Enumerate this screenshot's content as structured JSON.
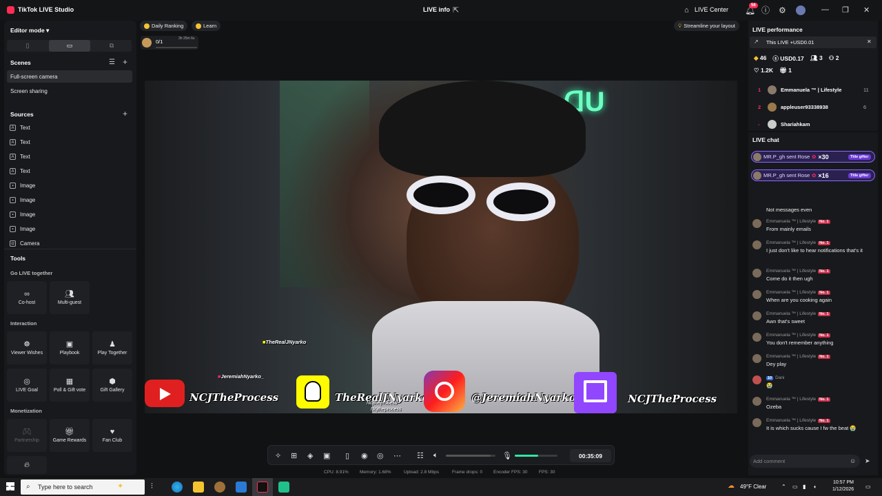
{
  "titlebar": {
    "app": "TikTok LIVE Studio",
    "center": "LIVE info",
    "live_center": "LIVE Center",
    "notif_count": "56"
  },
  "left": {
    "editor_mode": "Editor mode",
    "scenes_title": "Scenes",
    "scenes": [
      "Full-screen camera",
      "Screen sharing"
    ],
    "sources_title": "Sources",
    "sources": [
      {
        "icon": "text-icon",
        "label": "Text"
      },
      {
        "icon": "text-icon",
        "label": "Text"
      },
      {
        "icon": "text-icon",
        "label": "Text"
      },
      {
        "icon": "text-icon",
        "label": "Text"
      },
      {
        "icon": "image-icon",
        "label": "Image"
      },
      {
        "icon": "image-icon",
        "label": "Image"
      },
      {
        "icon": "image-icon",
        "label": "Image"
      },
      {
        "icon": "image-icon",
        "label": "Image"
      },
      {
        "icon": "camera-icon",
        "label": "Camera"
      }
    ],
    "tools_title": "Tools",
    "go_live_together": "Go LIVE together",
    "cohost": "Co-host",
    "multiguest": "Multi-guest",
    "interaction": "Interaction",
    "viewer_wishes": "Viewer Wishes",
    "playbook": "Playbook",
    "play_together": "Play Together",
    "live_goal": "LIVE Goal",
    "poll_gift": "Poll & Gift vote",
    "gift_gallery": "Gift Gallery",
    "monetization": "Monetization",
    "partnership": "Partnership",
    "game_rewards": "Game Rewards",
    "fan_club": "Fan Club"
  },
  "top": {
    "daily_ranking": "Daily Ranking",
    "learn": "Learn",
    "progress": "0/1",
    "timer_small": "3h 25m 6s",
    "streamline": "Streamline your layout"
  },
  "overlay": {
    "tag1": "TheRealJNyarko",
    "tag2": "JeremiahNyarko_",
    "yt": "NCJTheProcess",
    "snap": "TheRealJNyarko",
    "ig": "@JeremiahNyarko_",
    "twitch": "NCJTheProcess",
    "small1": "Ncjtheprocess",
    "small2": "Ncjtheprocess"
  },
  "controls": {
    "timer": "00:35:09",
    "volume_level": 0.9,
    "mic_level": 0.55
  },
  "stats": {
    "cpu": "CPU:  8.91%",
    "memory": "Memory:  1.68%",
    "upload": "Upload:  2.8 Mbps",
    "frame_drops": "Frame drops:  0",
    "encoder_fps": "Encoder FPS:  30",
    "fps": "FPS:  30"
  },
  "performance": {
    "title": "LIVE performance",
    "this_live": "This LIVE +USD0.01",
    "diamonds": "46",
    "usd": "USD0.17",
    "viewers": "3",
    "new": "2",
    "likes": "1.2K",
    "gifts": "1",
    "ranking": [
      {
        "num": "1",
        "name": "Emmanuela ™ | Lifestyle",
        "score": "11"
      },
      {
        "num": "2",
        "name": "appleuser93338938",
        "score": "6"
      },
      {
        "num": "-",
        "name": "Shariahkam",
        "score": ""
      }
    ]
  },
  "chat": {
    "title": "LIVE chat",
    "gifts": [
      {
        "text": "MR.P_gh sent Rose",
        "count": "×30",
        "tag": "Title gifter"
      },
      {
        "text": "MR.P_gh sent Rose",
        "count": "×16",
        "tag": "Title gifter"
      }
    ],
    "first_text": "Not messages even",
    "messages": [
      {
        "name": "Emmanuela ™ | Lifestyle",
        "badge": "No. 1",
        "text": "From mainly emails"
      },
      {
        "name": "Emmanuela ™ | Lifestyle",
        "badge": "No. 1",
        "text": "I just don't like to hear notifications that's it"
      },
      {
        "name": "Emmanuela ™ | Lifestyle",
        "badge": "No. 1",
        "text": "Come do it then ugh"
      },
      {
        "name": "Emmanuela ™ | Lifestyle",
        "badge": "No. 1",
        "text": "When are you cooking again"
      },
      {
        "name": "Emmanuela ™ | Lifestyle",
        "badge": "No. 1",
        "text": "Awn that's sweet"
      },
      {
        "name": "Emmanuela ™ | Lifestyle",
        "badge": "No. 1",
        "text": "You don't remember anything"
      },
      {
        "name": "Emmanuela ™ | Lifestyle",
        "badge": "No. 1",
        "text": "Dey play"
      },
      {
        "name": "Dani",
        "badge": "10",
        "text": "😭"
      },
      {
        "name": "Emmanuela ™ | Lifestyle",
        "badge": "No. 1",
        "text": "Ozeba"
      },
      {
        "name": "Emmanuela ™ | Lifestyle",
        "badge": "No. 1",
        "text": "It is which sucks cause I fw the beat 😭"
      }
    ],
    "comment_placeholder": "Add comment"
  },
  "taskbar": {
    "search": "Type here to search",
    "weather": "49°F  Clear",
    "time": "10:57 PM",
    "date": "1/12/2026"
  }
}
